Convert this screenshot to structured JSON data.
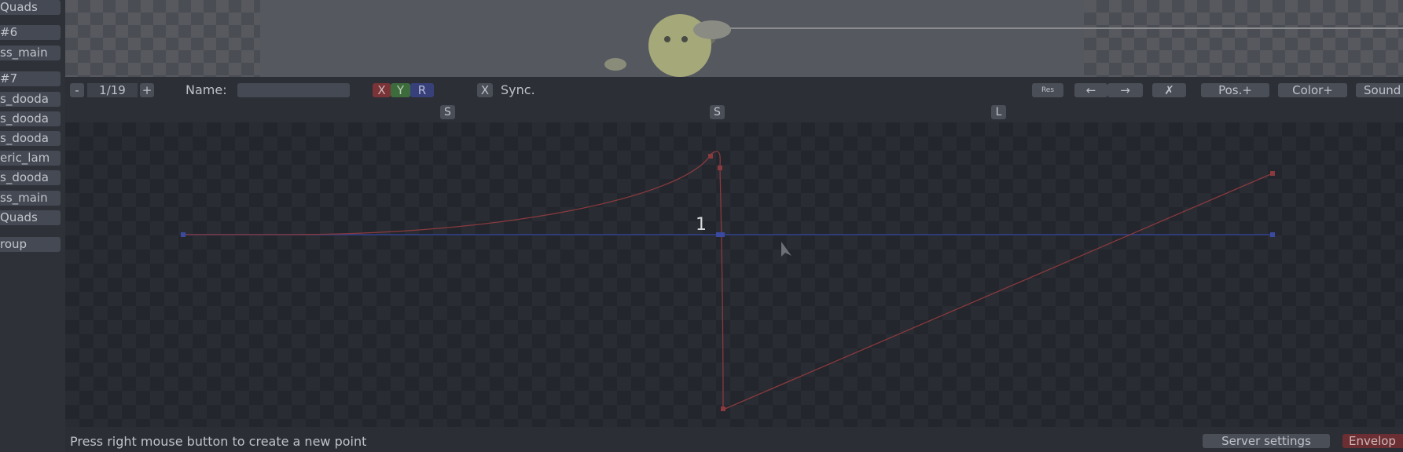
{
  "sidebar": {
    "items": [
      {
        "label": "Quads"
      },
      {
        "label": "#6"
      },
      {
        "label": "ss_main"
      },
      {
        "label": "#7"
      },
      {
        "label": "s_dooda"
      },
      {
        "label": "s_dooda"
      },
      {
        "label": "s_dooda"
      },
      {
        "label": "eric_lam"
      },
      {
        "label": "s_dooda"
      },
      {
        "label": "ss_main"
      },
      {
        "label": "Quads"
      },
      {
        "label": "roup"
      }
    ]
  },
  "toolbar": {
    "prev_label": "-",
    "envelope_index": "1/19",
    "next_label": "+",
    "name_label": "Name:",
    "name_value": "",
    "channel_x": "X",
    "channel_y": "Y",
    "channel_r": "R",
    "sync_toggle": "X",
    "sync_label": "Sync.",
    "res_label": "Res",
    "move_left_label": "←",
    "move_right_label": "→",
    "delete_label": "✗",
    "pos_add_label": "Pos.+",
    "color_add_label": "Color+",
    "sound_add_label": "Sound"
  },
  "curve_markers": [
    "S",
    "S",
    "L"
  ],
  "graph": {
    "selected_point_label": "1",
    "colors": {
      "red_channel": "#8a3a3e",
      "blue_channel": "#3a4aa0"
    }
  },
  "statusbar": {
    "hint": "Press right mouse button to create a new point",
    "server_settings": "Server settings",
    "envelopes": "Envelop"
  }
}
